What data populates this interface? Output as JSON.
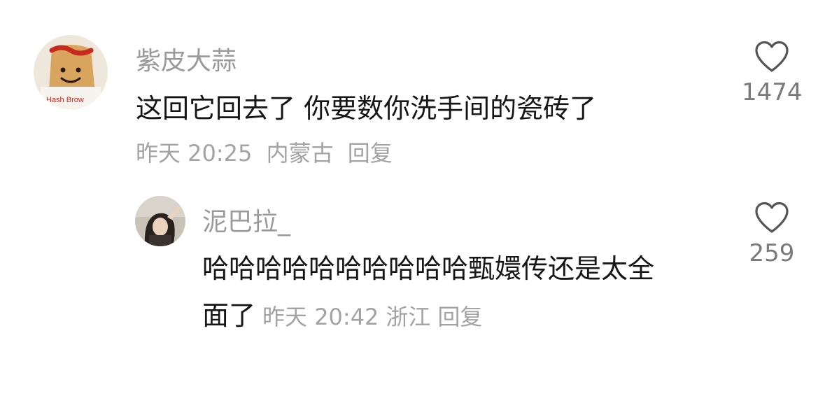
{
  "comments": [
    {
      "username": "紫皮大蒜",
      "text": "这回它回去了 你要数你洗手间的瓷砖了",
      "time": "昨天 20:25",
      "location": "内蒙古",
      "reply_label": "回复",
      "likes": "1474",
      "avatar_label": "Hash Brow"
    },
    {
      "username": "泥巴拉_",
      "text_line1": "哈哈哈哈哈哈哈哈哈哈甄嬛传还是太全",
      "text_line2": "面了",
      "time": "昨天 20:42",
      "location": "浙江",
      "reply_label": "回复",
      "likes": "259"
    }
  ],
  "icons": {
    "like": "heart-outline-icon"
  },
  "colors": {
    "username": "#9a9a9a",
    "text": "#161616",
    "meta": "#a3a3a3",
    "count": "#7a7a7a"
  }
}
